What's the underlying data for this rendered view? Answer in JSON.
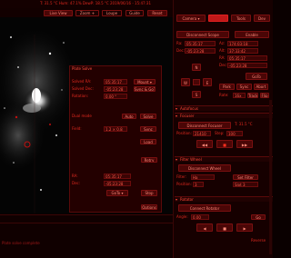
{
  "topbar": {
    "status": "T: 31.5 °C    Hum: 47.1%    DewP: 18.5 °C        2019/06/16 - 15:47:31"
  },
  "toolbar": {
    "live_view": "Live View",
    "zoom": "Zoom +",
    "loupe": "Loupe",
    "guide": "Guide",
    "reset": "Reset"
  },
  "tabs": {
    "camera": "Camera ▾",
    "tab2": "",
    "tools": "Tools",
    "dev": "Dev"
  },
  "camera_panel": {
    "disconnect": "Disconnect Scope",
    "enable": "Enable",
    "ra_label": "Ra:",
    "ra_value": "05:35:17",
    "dec_label": "Dec:",
    "dec_value": "-05:23:28",
    "az_label": "Az:",
    "az_value": "174:03:18",
    "alt_label": "Alt:",
    "alt_value": "37:33:42",
    "tgt_ra_label": "RA:",
    "tgt_ra_value": "05:35:17",
    "tgt_dec_label": "Dec:",
    "tgt_dec_value": "-05:23:28",
    "goto": "GoTo",
    "park": "Park",
    "sync": "Sync",
    "abort": "Abort",
    "north": "N",
    "south": "S",
    "west": "W",
    "east": "E",
    "rate_label": "Rate:",
    "rate_value": "16x",
    "track": "Track",
    "flip": "Flip"
  },
  "focuser": {
    "header": "Autofocus",
    "title": "Focuser",
    "disconnect": "Disconnect Focuser",
    "position_label": "Position:",
    "position_value": "21410",
    "step_label": "Step:",
    "step_value": "100",
    "in": "◀◀",
    "stop": "■",
    "out": "▶▶",
    "temp": "T: 31.5 °C"
  },
  "filter": {
    "header": "Filter Wheel",
    "disconnect": "Disconnect Wheel",
    "filter_label": "Filter:",
    "filter_value": "Ha",
    "set": "Set Filter",
    "position_label": "Position:",
    "position_value": "3",
    "slot": "Slot 3"
  },
  "rotator": {
    "header": "Rotator",
    "connect": "Connect Rotator",
    "angle_label": "Angle:",
    "angle_value": "0.00",
    "go": "Go",
    "reverse": "Reverse"
  },
  "overlay": {
    "title": "Plate Solve",
    "row1_label": "Solved RA:",
    "row1_value": "05:35:17",
    "row2_label": "Solved Dec:",
    "row2_value": "-05:23:28",
    "row3_label": "Rotation:",
    "row3_value": "0.00 °",
    "mode": "Mount ▾",
    "sync_goto": "Sync & GoTo",
    "dual": "Dual mode",
    "auto": "Auto",
    "field_label": "Field:",
    "field_value": "1.2 × 0.8",
    "solve": "Solve",
    "sync": "Sync",
    "load": "Load",
    "ra_label": "RA:",
    "ra_value": "05:35:17",
    "dec_label": "Dec:",
    "dec_value": "-05:23:28",
    "goto": "GoTo ▾",
    "stop": "Stop",
    "retry": "Retry",
    "options": "Options"
  },
  "log": {
    "line1": "Plate solve complete"
  }
}
